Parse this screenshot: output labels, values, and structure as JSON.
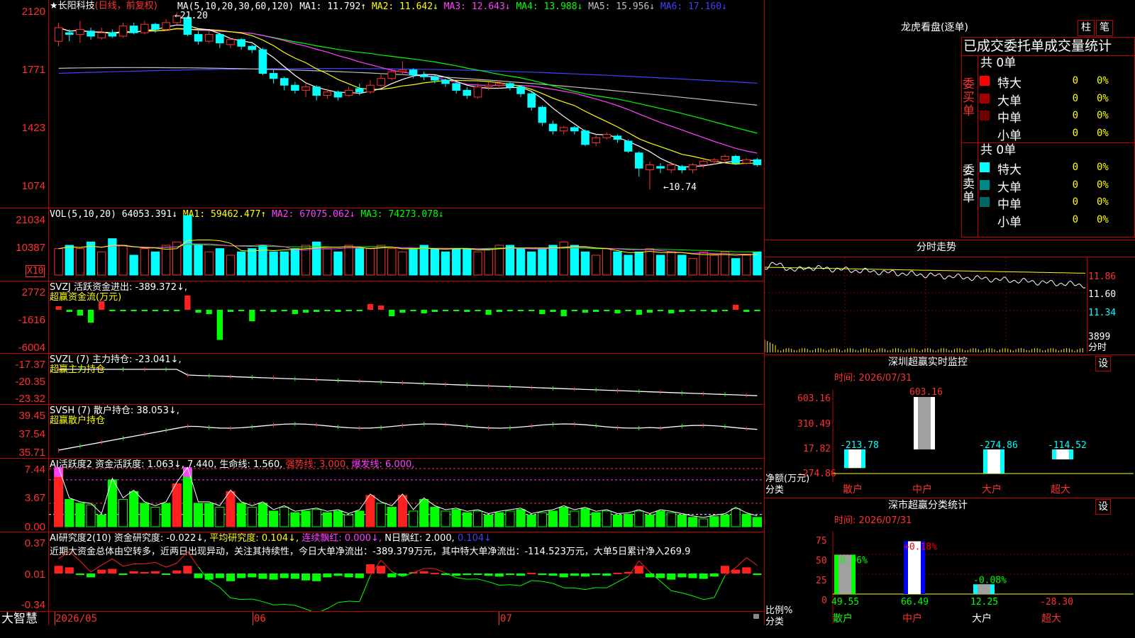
{
  "stock": {
    "title": "★长阳科技",
    "mode": "(日线，前复权)"
  },
  "main_ma": {
    "label": "MA(5,10,20,30,60,120)",
    "items": [
      {
        "text": "MA1: 11.792↑",
        "color": "#ffffff"
      },
      {
        "text": "MA2: 11.642↓",
        "color": "#ffff00"
      },
      {
        "text": "MA3: 12.643↓",
        "color": "#ff40ff"
      },
      {
        "text": "MA4: 13.988↓",
        "color": "#00ff00"
      },
      {
        "text": "MA5: 15.956↓",
        "color": "#c0c0c0"
      },
      {
        "text": "MA6: 17.160↓",
        "color": "#4040ff"
      }
    ]
  },
  "price_axis": [
    "2120",
    "1771",
    "1423",
    "1074"
  ],
  "price_marks": {
    "high": "←21.20",
    "low": "←10.74"
  },
  "candles": [
    [
      19.5,
      20.3,
      19.2,
      20.6
    ],
    [
      20.0,
      19.9,
      19.5,
      20.2
    ],
    [
      19.9,
      20.2,
      19.4,
      20.7
    ],
    [
      20.1,
      19.8,
      19.6,
      20.3
    ],
    [
      19.7,
      20.0,
      19.6,
      20.3
    ],
    [
      20.0,
      19.8,
      19.7,
      20.2
    ],
    [
      19.8,
      20.4,
      19.7,
      20.6
    ],
    [
      20.4,
      20.0,
      19.9,
      20.6
    ],
    [
      20.0,
      20.5,
      19.9,
      20.7
    ],
    [
      20.5,
      20.2,
      20.0,
      20.6
    ],
    [
      20.2,
      20.6,
      20.1,
      20.8
    ],
    [
      20.6,
      21.0,
      20.5,
      21.2
    ],
    [
      20.9,
      19.9,
      19.8,
      21.0
    ],
    [
      19.9,
      19.5,
      19.3,
      20.1
    ],
    [
      19.5,
      19.9,
      19.4,
      20.1
    ],
    [
      19.9,
      19.4,
      19.1,
      20.0
    ],
    [
      19.3,
      19.6,
      19.1,
      19.7
    ],
    [
      19.6,
      19.2,
      19.0,
      19.7
    ],
    [
      19.2,
      19.0,
      18.8,
      19.3
    ],
    [
      19.0,
      17.6,
      17.5,
      19.1
    ],
    [
      17.6,
      17.3,
      17.0,
      17.8
    ],
    [
      17.3,
      16.9,
      16.6,
      17.4
    ],
    [
      16.9,
      16.6,
      16.4,
      17.1
    ],
    [
      16.6,
      16.8,
      16.2,
      17.0
    ],
    [
      16.8,
      16.3,
      16.0,
      16.9
    ],
    [
      16.3,
      16.5,
      16.1,
      16.7
    ],
    [
      16.5,
      16.2,
      16.0,
      16.6
    ],
    [
      16.3,
      16.6,
      16.2,
      16.8
    ],
    [
      16.7,
      16.5,
      16.3,
      17.0
    ],
    [
      16.5,
      16.9,
      16.4,
      17.2
    ],
    [
      16.9,
      17.3,
      16.8,
      17.6
    ],
    [
      17.3,
      17.7,
      17.2,
      17.9
    ],
    [
      17.7,
      17.8,
      17.5,
      18.3
    ],
    [
      17.8,
      17.5,
      17.3,
      17.9
    ],
    [
      17.5,
      17.4,
      17.2,
      17.7
    ],
    [
      17.4,
      17.2,
      17.0,
      17.5
    ],
    [
      17.2,
      17.0,
      16.8,
      17.3
    ],
    [
      17.0,
      16.6,
      16.4,
      17.1
    ],
    [
      16.6,
      16.3,
      16.1,
      16.8
    ],
    [
      16.2,
      16.8,
      16.1,
      17.0
    ],
    [
      16.8,
      16.9,
      16.6,
      17.1
    ],
    [
      16.9,
      17.0,
      16.7,
      17.2
    ],
    [
      17.0,
      16.8,
      16.6,
      17.1
    ],
    [
      16.8,
      16.4,
      16.2,
      16.9
    ],
    [
      16.4,
      15.6,
      15.4,
      16.5
    ],
    [
      15.6,
      14.7,
      14.5,
      15.7
    ],
    [
      14.6,
      14.2,
      14.0,
      14.8
    ],
    [
      14.2,
      14.4,
      14.0,
      14.5
    ],
    [
      14.4,
      14.2,
      14.0,
      14.5
    ],
    [
      14.2,
      13.4,
      13.3,
      14.3
    ],
    [
      13.5,
      13.8,
      13.3,
      14.0
    ],
    [
      13.8,
      14.0,
      13.7,
      14.1
    ],
    [
      13.9,
      13.7,
      13.5,
      14.0
    ],
    [
      13.6,
      13.0,
      12.9,
      13.7
    ],
    [
      12.9,
      12.0,
      11.5,
      13.0
    ],
    [
      11.9,
      12.2,
      10.74,
      12.4
    ],
    [
      12.1,
      12.0,
      11.7,
      12.3
    ],
    [
      11.9,
      12.2,
      11.7,
      12.4
    ],
    [
      12.1,
      11.9,
      11.7,
      12.2
    ],
    [
      11.9,
      12.2,
      11.7,
      12.3
    ],
    [
      12.2,
      12.4,
      12.0,
      12.5
    ],
    [
      12.4,
      12.5,
      12.2,
      12.6
    ],
    [
      12.5,
      12.7,
      12.3,
      12.8
    ],
    [
      12.7,
      12.3,
      12.2,
      12.8
    ],
    [
      12.3,
      12.5,
      12.2,
      12.6
    ],
    [
      12.5,
      12.2,
      12.1,
      12.6
    ]
  ],
  "vol_ma": {
    "label": "VOL(5,10,20)",
    "items": [
      {
        "text": "64053.391↓",
        "color": "#ffffff"
      },
      {
        "text": "MA1: 59462.477↑",
        "color": "#ffff00"
      },
      {
        "text": "MA2: 67075.062↓",
        "color": "#ff40ff"
      },
      {
        "text": "MA3: 74273.078↓",
        "color": "#00ff00"
      }
    ]
  },
  "vol_axis": [
    "21034",
    "10387"
  ],
  "vol_unit": "X10",
  "volumes": [
    8,
    9,
    8,
    10,
    7,
    11,
    9,
    6,
    8,
    7,
    9,
    10,
    18,
    9,
    7,
    8,
    6,
    7,
    8,
    9,
    7,
    7,
    8,
    9,
    10,
    8,
    7,
    9,
    8,
    8,
    9,
    8,
    7,
    8,
    9,
    8,
    7,
    8,
    8,
    7,
    8,
    9,
    9,
    8,
    7,
    8,
    9,
    10,
    9,
    7,
    6,
    8,
    7,
    6,
    7,
    8,
    6,
    7,
    6,
    5,
    7,
    6,
    7,
    5,
    6,
    7
  ],
  "svzj": {
    "label": "SVZJ  活跃资金进出: -389.372↓,",
    "sub": "超赢资金流(万元)",
    "axis": [
      "2772",
      "-1616",
      "-6004"
    ]
  },
  "svzj_vals": [
    500,
    -300,
    -800,
    -1800,
    1200,
    -200,
    -100,
    -150,
    -200,
    -100,
    -150,
    -200,
    2000,
    -400,
    -600,
    -4200,
    -300,
    -200,
    -1600,
    -200,
    -300,
    -100,
    -600,
    -400,
    -300,
    -200,
    -300,
    -150,
    -200,
    800,
    600,
    -900,
    -400,
    -100,
    -500,
    -300,
    -200,
    -150,
    -300,
    -100,
    -700,
    -300,
    -200,
    -150,
    -200,
    -600,
    -300,
    -900,
    -200,
    -400,
    -300,
    -200,
    -500,
    -150,
    -700,
    -400,
    -200,
    -500,
    -300,
    -200,
    -150,
    -300,
    -100,
    700,
    -300,
    -200
  ],
  "svzl": {
    "label": "SVZL (7) 主力持仓: -23.041↓,",
    "sub": "超赢主力持仓",
    "axis": [
      "-17.37",
      "-20.35",
      "-23.32"
    ]
  },
  "svsh": {
    "label": "SVSH (7) 散户持仓: 38.053↓,",
    "sub": "超赢散户持仓",
    "axis": [
      "39.45",
      "37.54",
      "35.71"
    ]
  },
  "ai1": {
    "label": "AI活跃度2 资金活跃度: 1.063↓, 7.440, 生命线: 1.560,",
    "strong": "强势线: 3.000,",
    "burst": "爆发线: 6.000,",
    "axis": [
      "7.44",
      "3.67",
      "0.00"
    ]
  },
  "ai1_vals": [
    7.4,
    3.5,
    3.0,
    2.8,
    1.5,
    6.0,
    3.5,
    4.5,
    3.0,
    2.5,
    3.0,
    5.5,
    7.4,
    3.0,
    3.0,
    2.5,
    4.5,
    3.0,
    2.5,
    3.0,
    2.0,
    2.5,
    1.8,
    2.0,
    2.2,
    1.8,
    2.0,
    1.5,
    2.0,
    4.0,
    3.0,
    2.5,
    4.0,
    2.0,
    3.5,
    2.5,
    2.0,
    2.2,
    1.8,
    2.0,
    1.5,
    1.8,
    2.0,
    2.2,
    1.5,
    1.8,
    2.0,
    2.5,
    2.0,
    2.3,
    1.8,
    2.0,
    1.5,
    1.6,
    2.0,
    1.5,
    2.0,
    1.8,
    1.5,
    1.2,
    1.0,
    1.3,
    1.5,
    2.3,
    1.6,
    1.2
  ],
  "ai2": {
    "label": "AI研究度2(10) 资金研究度: -0.022↓,",
    "avg": "平均研究度: 0.104↓,",
    "red": "连续飘红: 0.000↓,",
    "n": "N日飘红: 2.000,",
    "last": "0.104↓",
    "axis": [
      "0.37",
      "0.01",
      "-0.34"
    ]
  },
  "ai2_text": "近期大资金总体由空转多，近两日出现异动，关注其持续性，今日大单净流出：-389.379万元，其中特大单净流出：-114.523万元，大单5日累计净入269.9",
  "ai2_vals": [
    0.1,
    0.08,
    -0.02,
    -0.05,
    0.05,
    0.06,
    -0.02,
    0.03,
    0.02,
    0.03,
    -0.01,
    0.04,
    0.1,
    -0.06,
    -0.08,
    -0.06,
    -0.1,
    -0.06,
    -0.05,
    -0.07,
    -0.08,
    -0.06,
    -0.07,
    -0.09,
    -0.1,
    -0.05,
    -0.03,
    -0.05,
    -0.06,
    0.12,
    0.1,
    -0.05,
    -0.03,
    0.02,
    0.03,
    0.01,
    -0.02,
    -0.03,
    -0.02,
    -0.01,
    -0.03,
    -0.04,
    -0.02,
    -0.03,
    0.01,
    -0.02,
    -0.03,
    -0.05,
    -0.03,
    -0.04,
    -0.02,
    -0.03,
    0.01,
    0.02,
    0.1,
    -0.05,
    -0.06,
    -0.08,
    -0.05,
    -0.06,
    -0.07,
    -0.04,
    0.1,
    0.05,
    0.08,
    -0.02
  ],
  "date_axis": {
    "start": "2026/05",
    "m6": "06",
    "m7": "07"
  },
  "brand": "大智慧",
  "right": {
    "lhb_title": "龙虎看盘(逐单)",
    "btn_zhu": "柱",
    "btn_bi": "笔",
    "stat_header": "已成交委托单成交量统计",
    "buy_label": "委买单",
    "sell_label": "委卖单",
    "buy_total": "共 0单",
    "sell_total": "共 0单",
    "buy_rows": [
      {
        "label": "特大",
        "count": "0",
        "pct": "0%",
        "color": "#ff0000"
      },
      {
        "label": "大单",
        "count": "0",
        "pct": "0%",
        "color": "#a00000"
      },
      {
        "label": "中单",
        "count": "0",
        "pct": "0%",
        "color": "#700000"
      },
      {
        "label": "小单",
        "count": "0",
        "pct": "0%",
        "color": "#000000"
      }
    ],
    "sell_rows": [
      {
        "label": "特大",
        "count": "0",
        "pct": "0%",
        "color": "#00ffff"
      },
      {
        "label": "大单",
        "count": "0",
        "pct": "0%",
        "color": "#008888"
      },
      {
        "label": "中单",
        "count": "0",
        "pct": "0%",
        "color": "#006666"
      },
      {
        "label": "小单",
        "count": "0",
        "pct": "0%",
        "color": "#000000"
      }
    ],
    "intraday_title": "分时走势",
    "intraday_axis": [
      "11.86",
      "11.60",
      "11.34",
      "3899"
    ],
    "intraday_unit": "分时",
    "sz_title": "深圳超赢实时监控",
    "sz_btn": "设",
    "sz_time": "时间: 2026/07/31",
    "sz_axis": [
      "603.16",
      "310.49",
      "17.82",
      "-274.86"
    ],
    "sz_ylabel": "净额(万元)",
    "sz_xlabel": "分类",
    "sz_bars": [
      {
        "cat": "散户",
        "value": -213.78,
        "label": "-213.78"
      },
      {
        "cat": "中户",
        "value": 603.16,
        "label": "603.16"
      },
      {
        "cat": "大户",
        "value": -274.86,
        "label": "-274.86"
      },
      {
        "cat": "超大",
        "value": -114.52,
        "label": "-114.52"
      }
    ],
    "sm_title": "深市超赢分类统计",
    "sm_btn": "设",
    "sm_time": "时间: 2026/07/31",
    "sm_axis": [
      "75",
      "50",
      "25",
      "0"
    ],
    "sm_ylabel": "比例%",
    "sm_xlabel": "分类",
    "sm_bars": [
      {
        "cat": "散户",
        "value": 49.55,
        "change": "-0.06%",
        "color": "#00ff00"
      },
      {
        "cat": "中户",
        "value": 66.49,
        "change": "+0.18%",
        "color": "#ff0000"
      },
      {
        "cat": "大户",
        "value": 12.25,
        "change": "-0.08%",
        "color": "#00ff00"
      },
      {
        "cat": "超大",
        "value": -28.3,
        "change": "",
        "color": "#ff0000"
      }
    ]
  }
}
